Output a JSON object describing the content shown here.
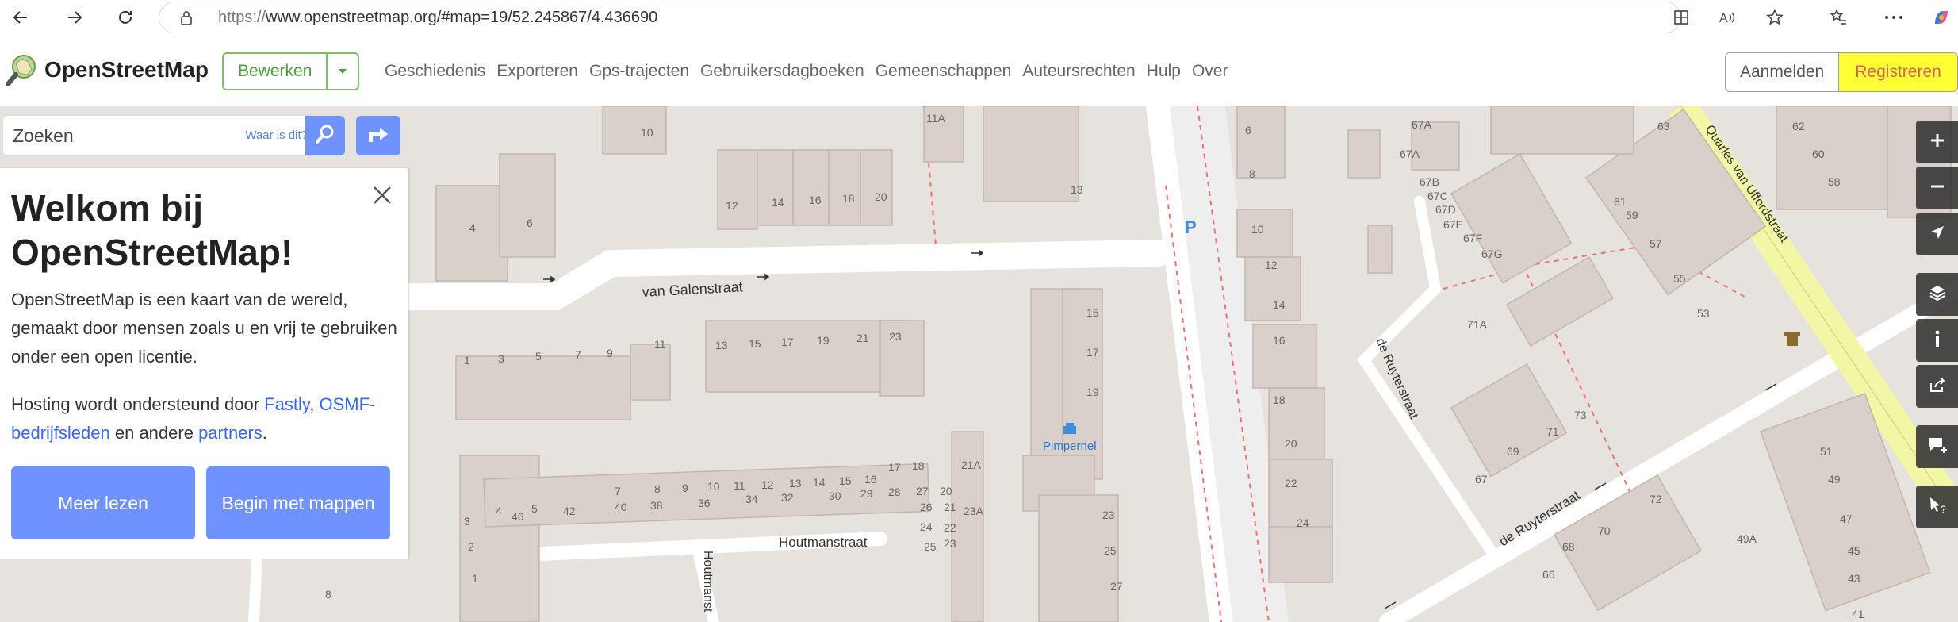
{
  "browser": {
    "url_protocol": "https://",
    "url_rest": "www.openstreetmap.org/#map=19/52.245867/4.436690"
  },
  "header": {
    "brand": "OpenStreetMap",
    "edit_label": "Bewerken",
    "nav": [
      "Geschiedenis",
      "Exporteren",
      "Gps-trajecten",
      "Gebruikersdagboeken",
      "Gemeenschappen",
      "Auteursrechten",
      "Hulp",
      "Over"
    ],
    "login_label": "Aanmelden",
    "register_label": "Registreren"
  },
  "search": {
    "placeholder": "Zoeken",
    "where_is_this": "Waar is dit?"
  },
  "welcome": {
    "title": "Welkom bij OpenStreetMap!",
    "intro": "OpenStreetMap is een kaart van de wereld, gemaakt door mensen zoals u en vrij te gebruiken onder een open licentie.",
    "hosting_prefix": "Hosting wordt ondersteund door ",
    "link_fastly": "Fastly",
    "sep1": ", ",
    "link_osmf": "OSMF-bedrijfsleden",
    "mid": " en andere ",
    "link_partners": "partners",
    "end": ".",
    "read_more": "Meer lezen",
    "start_mapping": "Begin met mappen"
  },
  "map_labels": {
    "street_galen": "van Galenstraat",
    "street_houtman": "Houtmanstraat",
    "street_houtman_v": "Houtmanst",
    "street_ruyter_v": "de Ruyterstraat",
    "street_ruyter_d": "de Ruyterstraat",
    "street_quarles": "Quarles van Uffordstraat",
    "poi_pimpernel": "Pimpernel",
    "parking": "P"
  },
  "colors": {
    "accent": "#7092ff",
    "edit_green": "#7ebc6f",
    "highlight": "#ffff33",
    "building": "#d9d0c9",
    "map_bg": "#e6e2dd"
  }
}
